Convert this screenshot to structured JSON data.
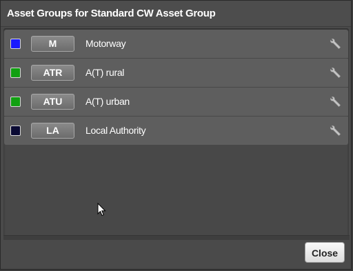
{
  "dialog": {
    "title": "Asset Groups for Standard CW Asset Group",
    "close_label": "Close"
  },
  "asset_groups": [
    {
      "code": "M",
      "name": "Motorway",
      "color": "#1a1aff",
      "action_icon": "wrench-icon"
    },
    {
      "code": "ATR",
      "name": "A(T) rural",
      "color": "#11a011",
      "action_icon": "wrench-icon"
    },
    {
      "code": "ATU",
      "name": "A(T) urban",
      "color": "#11a011",
      "action_icon": "wrench-icon"
    },
    {
      "code": "LA",
      "name": "Local Authority",
      "color": "#0a0a33",
      "action_icon": "wrench-icon"
    }
  ],
  "cursor_icon": "mouse-pointer-icon"
}
